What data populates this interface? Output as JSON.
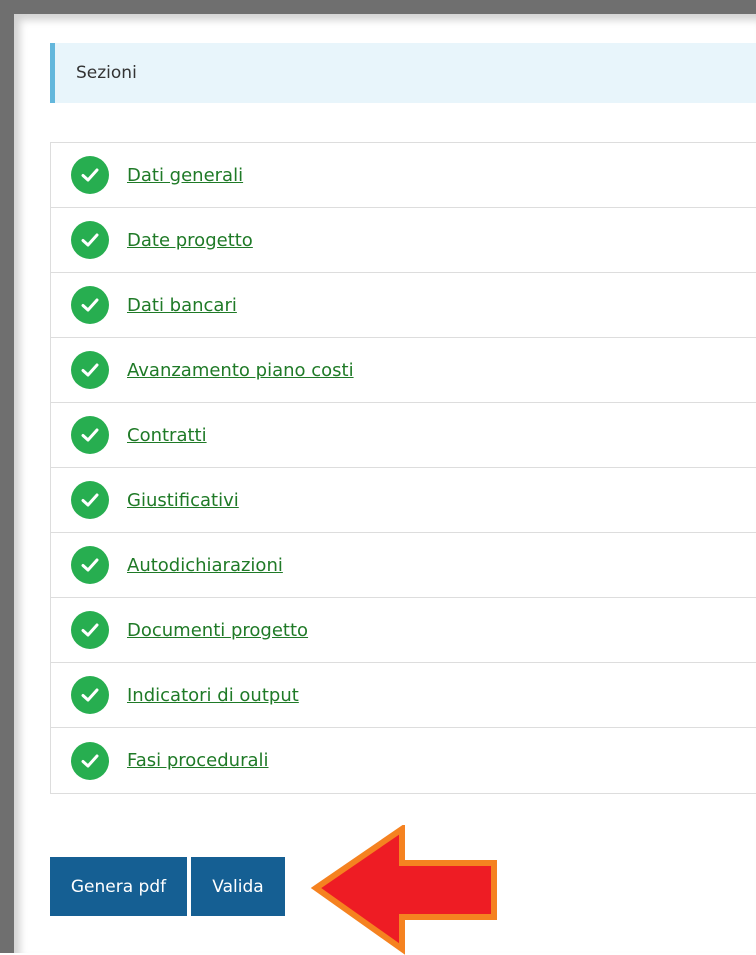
{
  "section": {
    "title": "Sezioni"
  },
  "sections": [
    {
      "label": "Dati generali",
      "status": "complete"
    },
    {
      "label": "Date progetto",
      "status": "complete"
    },
    {
      "label": "Dati bancari",
      "status": "complete"
    },
    {
      "label": "Avanzamento piano costi",
      "status": "complete"
    },
    {
      "label": "Contratti",
      "status": "complete"
    },
    {
      "label": "Giustificativi",
      "status": "complete"
    },
    {
      "label": "Autodichiarazioni",
      "status": "complete"
    },
    {
      "label": "Documenti progetto",
      "status": "complete"
    },
    {
      "label": "Indicatori di output",
      "status": "complete"
    },
    {
      "label": "Fasi procedurali",
      "status": "complete"
    }
  ],
  "actions": {
    "generate_pdf_label": "Genera pdf",
    "validate_label": "Valida"
  },
  "colors": {
    "header_bg": "#e8f5fb",
    "header_accent": "#63b7dc",
    "check_green": "#27ae50",
    "link_green": "#1f7a27",
    "button_blue": "#155f93",
    "arrow_red": "#ee1c24",
    "arrow_outline": "#f58220"
  },
  "icons": {
    "status": "check-circle-icon",
    "pointer": "arrow-left-icon"
  }
}
